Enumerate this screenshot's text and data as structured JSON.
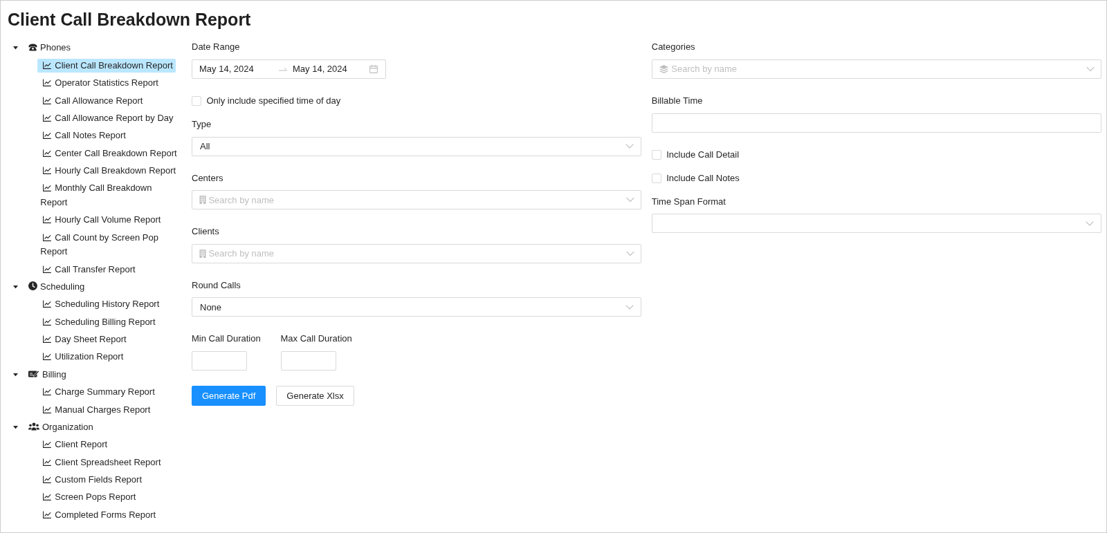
{
  "page": {
    "title": "Client Call Breakdown Report"
  },
  "sidebar": {
    "groups": [
      {
        "label": "Phones",
        "expanded": true,
        "items": [
          {
            "label": "Client Call Breakdown Report",
            "selected": true
          },
          {
            "label": "Operator Statistics Report",
            "selected": false
          },
          {
            "label": "Call Allowance Report",
            "selected": false
          },
          {
            "label": "Call Allowance Report by Day",
            "selected": false
          },
          {
            "label": "Call Notes Report",
            "selected": false
          },
          {
            "label": "Center Call Breakdown Report",
            "selected": false
          },
          {
            "label": "Hourly Call Breakdown Report",
            "selected": false
          },
          {
            "label": "Monthly Call Breakdown Report",
            "selected": false
          },
          {
            "label": "Hourly Call Volume Report",
            "selected": false
          },
          {
            "label": "Call Count by Screen Pop Report",
            "selected": false
          },
          {
            "label": "Call Transfer Report",
            "selected": false
          }
        ]
      },
      {
        "label": "Scheduling",
        "expanded": true,
        "items": [
          {
            "label": "Scheduling History Report",
            "selected": false
          },
          {
            "label": "Scheduling Billing Report",
            "selected": false
          },
          {
            "label": "Day Sheet Report",
            "selected": false
          },
          {
            "label": "Utilization Report",
            "selected": false
          }
        ]
      },
      {
        "label": "Billing",
        "expanded": true,
        "items": [
          {
            "label": "Charge Summary Report",
            "selected": false
          },
          {
            "label": "Manual Charges Report",
            "selected": false
          }
        ]
      },
      {
        "label": "Organization",
        "expanded": true,
        "items": [
          {
            "label": "Client Report",
            "selected": false
          },
          {
            "label": "Client Spreadsheet Report",
            "selected": false
          },
          {
            "label": "Custom Fields Report",
            "selected": false
          },
          {
            "label": "Screen Pops Report",
            "selected": false
          },
          {
            "label": "Completed Forms Report",
            "selected": false
          }
        ]
      }
    ]
  },
  "form": {
    "columns": [
      {
        "fields": [
          {
            "kind": "date_range",
            "label": "Date Range",
            "start": "May 14, 2024",
            "end": "May 14, 2024"
          },
          {
            "kind": "checkbox",
            "label": "Only include specified time of day",
            "checked": false
          },
          {
            "kind": "select",
            "label": "Type",
            "value": "All"
          },
          {
            "kind": "search_select",
            "label": "Centers",
            "placeholder": "Search by name"
          },
          {
            "kind": "search_select",
            "label": "Clients",
            "placeholder": "Search by name"
          },
          {
            "kind": "select",
            "label": "Round Calls",
            "value": "None"
          },
          {
            "kind": "duration_pair",
            "fields": [
              {
                "label": "Min Call Duration"
              },
              {
                "label": "Max Call Duration"
              }
            ]
          }
        ]
      },
      {
        "fields": [
          {
            "kind": "search_select",
            "label": "Categories",
            "placeholder": "Search by name"
          },
          {
            "kind": "text",
            "label": "Billable Time"
          },
          {
            "kind": "checkbox",
            "label": "Include Call Detail",
            "checked": false
          },
          {
            "kind": "checkbox",
            "label": "Include Call Notes",
            "checked": false
          },
          {
            "kind": "select",
            "label": "Time Span Format"
          }
        ]
      }
    ],
    "buttons": [
      {
        "label": "Generate Pdf",
        "kind": "primary"
      },
      {
        "label": "Generate Xlsx",
        "kind": "default"
      }
    ]
  }
}
